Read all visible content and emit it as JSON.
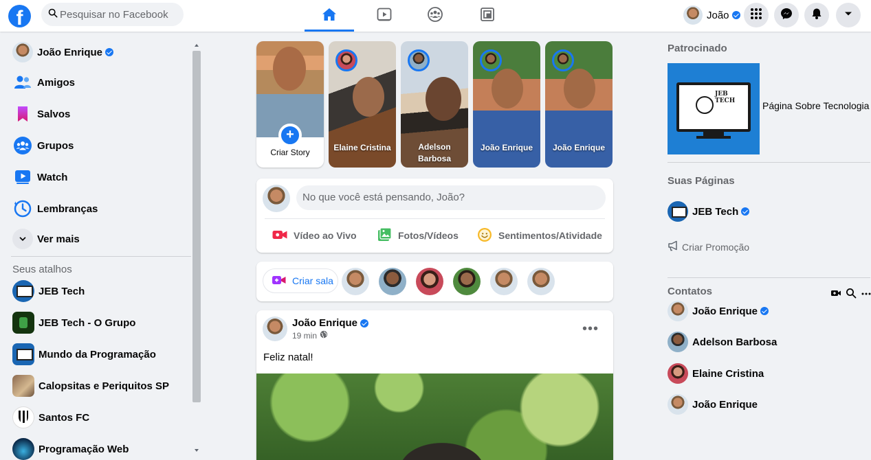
{
  "header": {
    "logo": "f",
    "search_placeholder": "Pesquisar no Facebook",
    "nav_tabs": [
      "home",
      "watch",
      "groups",
      "gaming"
    ],
    "profile_name": "João",
    "accent": "#1877f2"
  },
  "sidebar": {
    "user_name": "João Enrique",
    "items": [
      {
        "label": "Amigos",
        "icon": "friends-icon"
      },
      {
        "label": "Salvos",
        "icon": "saved-icon"
      },
      {
        "label": "Grupos",
        "icon": "groups-icon"
      },
      {
        "label": "Watch",
        "icon": "watch-icon"
      },
      {
        "label": "Lembranças",
        "icon": "memories-icon"
      },
      {
        "label": "Ver mais",
        "icon": "chevron-down-icon"
      }
    ],
    "shortcuts_title": "Seus atalhos",
    "shortcuts": [
      {
        "label": "JEB Tech"
      },
      {
        "label": "JEB Tech - O Grupo"
      },
      {
        "label": "Mundo da Programação"
      },
      {
        "label": "Calopsitas e Periquitos SP"
      },
      {
        "label": "Santos FC"
      },
      {
        "label": "Programação Web"
      }
    ]
  },
  "stories": {
    "create_label": "Criar Story",
    "items": [
      {
        "name": "Elaine Cristina"
      },
      {
        "name": "Adelson Barbosa"
      },
      {
        "name": "João Enrique"
      },
      {
        "name": "João Enrique"
      }
    ]
  },
  "composer": {
    "placeholder": "No que você está pensando, João?",
    "actions": [
      "Vídeo ao Vivo",
      "Fotos/Vídeos",
      "Sentimentos/Atividade"
    ]
  },
  "rooms": {
    "create_label": "Criar sala"
  },
  "post": {
    "author": "João Enrique",
    "time": "19 min",
    "text": "Feliz natal!"
  },
  "right": {
    "sponsored_title": "Patrocinado",
    "ad_brand": "JEB TECH",
    "ad_text": "Página Sobre Tecnologia",
    "pages_title": "Suas Páginas",
    "page_name": "JEB Tech",
    "promo_label": "Criar Promoção",
    "contacts_title": "Contatos",
    "contacts": [
      {
        "name": "João Enrique",
        "verified": true
      },
      {
        "name": "Adelson Barbosa",
        "verified": false
      },
      {
        "name": "Elaine Cristina",
        "verified": false
      },
      {
        "name": "João Enrique",
        "verified": false
      }
    ]
  }
}
